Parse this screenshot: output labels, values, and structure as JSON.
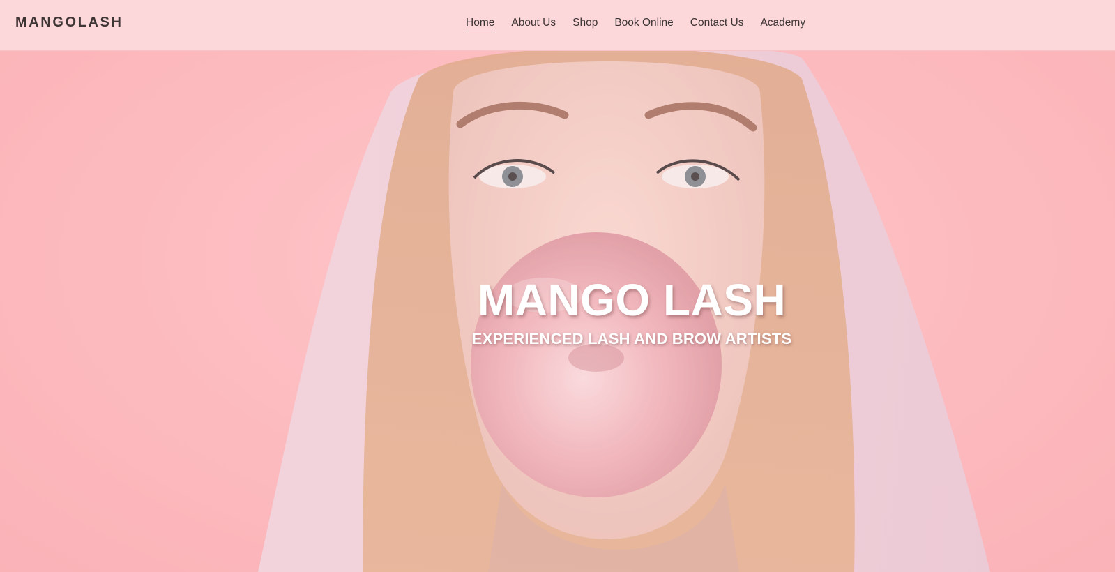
{
  "brand": {
    "logo_text": "MANGOLASH"
  },
  "nav": {
    "items": [
      {
        "label": "Home",
        "active": true
      },
      {
        "label": "About Us",
        "active": false
      },
      {
        "label": "Shop",
        "active": false
      },
      {
        "label": "Book Online",
        "active": false
      },
      {
        "label": "Contact Us",
        "active": false
      },
      {
        "label": "Academy",
        "active": false
      }
    ]
  },
  "hero": {
    "title": "MANGO LASH",
    "subtitle": "EXPERIENCED LASH AND BROW ARTISTS",
    "image_description": "woman in hood blowing pink bubble gum"
  },
  "colors": {
    "header_bg": "#fdd8da",
    "hero_bg": "#fbb6ba",
    "text_dark": "#3c3434",
    "hero_text": "#ffffff"
  }
}
